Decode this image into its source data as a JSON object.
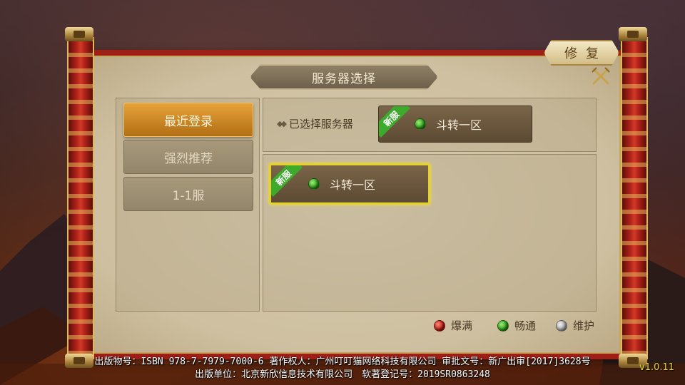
{
  "window": {
    "title": "服务器选择"
  },
  "repair_button": {
    "label": "修复"
  },
  "tabs": [
    {
      "label": "最近登录",
      "active": true
    },
    {
      "label": "强烈推荐",
      "active": false
    },
    {
      "label": "1-1服",
      "active": false
    }
  ],
  "selected_section": {
    "label": "已选择服务器",
    "server": {
      "badge": "新服",
      "name": "斗转一区",
      "status": "畅通"
    }
  },
  "server_list": [
    {
      "badge": "新服",
      "name": "斗转一区",
      "status": "畅通",
      "highlighted": true
    }
  ],
  "legend": [
    {
      "label": "爆满",
      "color": "#b81a14"
    },
    {
      "label": "畅通",
      "color": "#2e9a18"
    },
    {
      "label": "维护",
      "color": "#a9a9a9"
    }
  ],
  "footer": {
    "line1": "出版物号：ISBN 978-7-7979-7000-6 著作权人：广州叮叮猫网络科技有限公司 审批文号：新广出审[2017]3628号",
    "line2": "出版单位：北京新欣信息技术有限公司　软著登记号：2019SR0863248"
  },
  "version": "v1.0.11",
  "icons": {
    "close": "close-x-icon",
    "diamond": "diamond-bullet-icon"
  }
}
